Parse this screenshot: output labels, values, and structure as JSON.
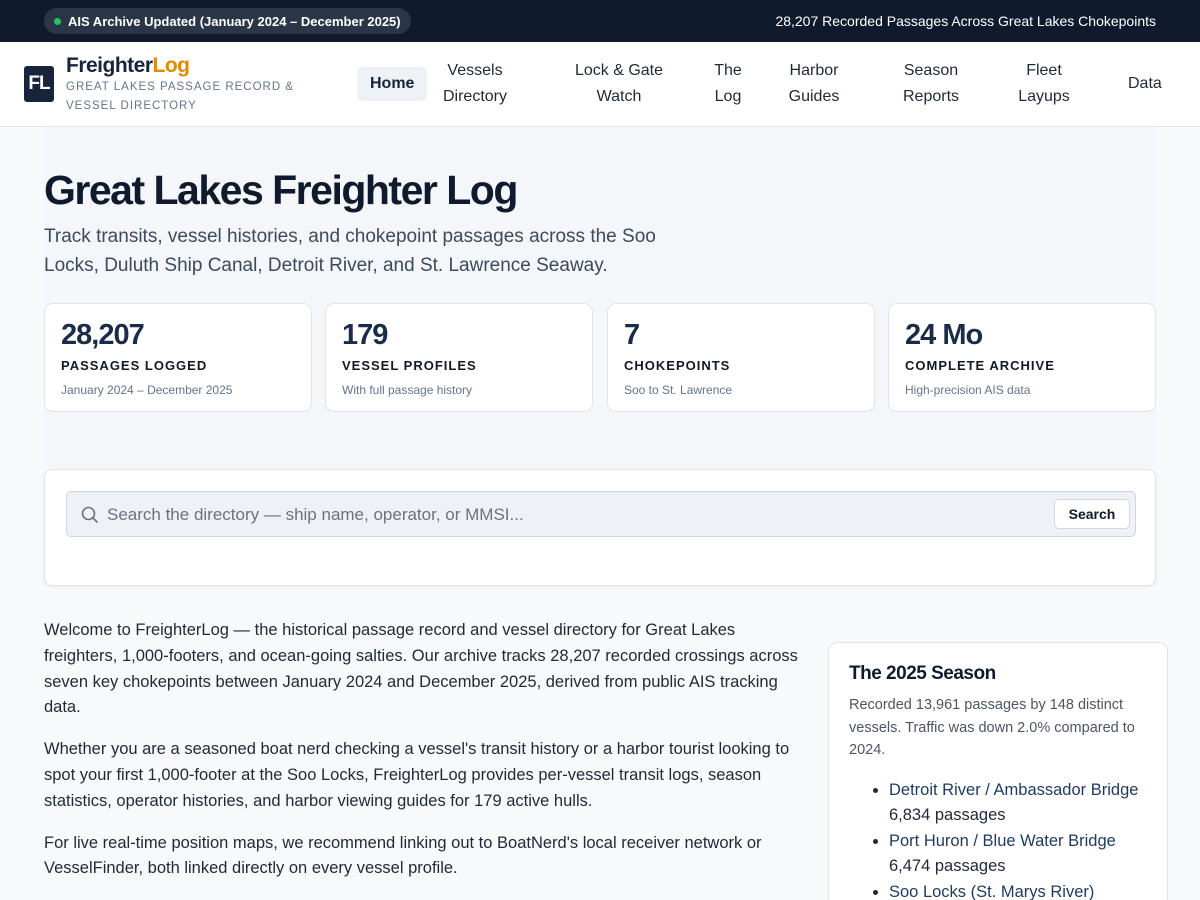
{
  "topbar": {
    "status": "AIS Archive Updated (January 2024 – December 2025)",
    "summary": "28,207 Recorded Passages Across Great Lakes Chokepoints",
    "status_color": "#22c55e"
  },
  "brand": {
    "mark": "FL",
    "name_main": "Freighter",
    "name_accent": "Log",
    "tagline": "GREAT LAKES PASSAGE RECORD & VESSEL DIRECTORY",
    "accent_color": "#e08a00"
  },
  "nav": {
    "home": "Home",
    "vessels": "Vessels Directory",
    "lock": "Lock & Gate Watch",
    "log": "The Log",
    "harbor": "Harbor Guides",
    "season": "Season Reports",
    "fleet": "Fleet Layups",
    "data": "Data"
  },
  "hero": {
    "title": "Great Lakes Freighter Log",
    "subtitle": "Track transits, vessel histories, and chokepoint passages across the Soo Locks, Duluth Ship Canal, Detroit River, and St. Lawrence Seaway."
  },
  "stats": [
    {
      "value": "28,207",
      "label": "PASSAGES LOGGED",
      "note": "January 2024 – December 2025"
    },
    {
      "value": "179",
      "label": "VESSEL PROFILES",
      "note": "With full passage history"
    },
    {
      "value": "7",
      "label": "CHOKEPOINTS",
      "note": "Soo to St. Lawrence"
    },
    {
      "value": "24 Mo",
      "label": "COMPLETE ARCHIVE",
      "note": "High-precision AIS data"
    }
  ],
  "search": {
    "placeholder": "Search the directory — ship name, operator, or MMSI...",
    "value": "",
    "button": "Search"
  },
  "intro": {
    "p1": "Welcome to FreighterLog — the historical passage record and vessel directory for Great Lakes freighters, 1,000-footers, and ocean-going salties. Our archive tracks 28,207 recorded crossings across seven key chokepoints between January 2024 and December 2025, derived from public AIS tracking data.",
    "p2": "Whether you are a seasoned boat nerd checking a vessel's transit history or a harbor tourist looking to spot your first 1,000-footer at the Soo Locks, FreighterLog provides per-vessel transit logs, season statistics, operator histories, and harbor viewing guides for 179 active hulls.",
    "p3": "For live real-time position maps, we recommend linking out to BoatNerd's local receiver network or VesselFinder, both linked directly on every vessel profile."
  },
  "season": {
    "title": "The 2025 Season",
    "summary": "Recorded 13,961 passages by 148 distinct vessels. Traffic was down 2.0% compared to 2024.",
    "routes": [
      {
        "name": "Detroit River / Ambassador Bridge",
        "count": "6,834 passages"
      },
      {
        "name": "Port Huron / Blue Water Bridge",
        "count": "6,474 passages"
      },
      {
        "name": "Soo Locks (St. Marys River)",
        "count": ""
      }
    ]
  }
}
